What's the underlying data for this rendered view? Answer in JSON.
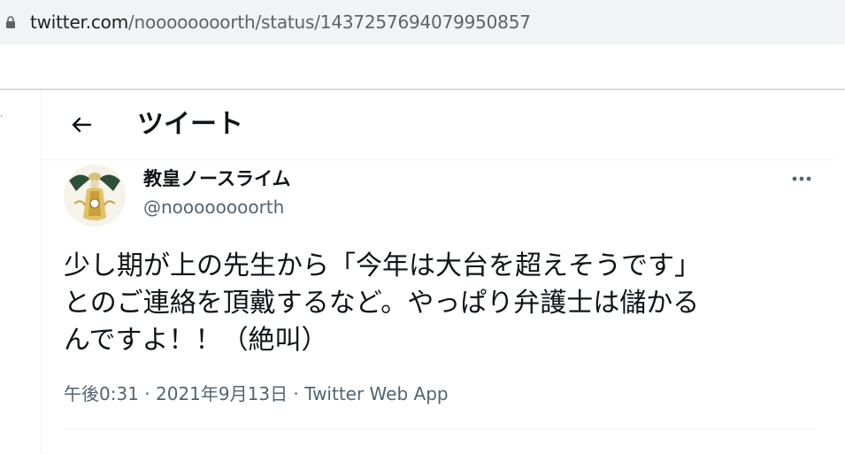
{
  "browser": {
    "url_host": "twitter.com",
    "url_path": "/noooooooorth/status/1437257694079950857"
  },
  "header": {
    "title": "ツイート"
  },
  "tweet": {
    "display_name": "教皇ノースライム",
    "handle": "@noooooooorth",
    "text_lines": [
      "少し期が上の先生から「今年は大台を超えそうです」",
      "とのご連絡を頂戴するなど。やっぱり弁護士は儲かる",
      "んですよ！！（絶叫）"
    ],
    "time": "午後0:31",
    "date": "2021年9月13日",
    "source": "Twitter Web App",
    "separator": " · "
  },
  "icons": {
    "lock": "lock-icon",
    "back": "arrow-left-icon",
    "more": "more-horizontal-icon",
    "avatar": "avatar-image"
  },
  "colors": {
    "text_primary": "#0f1419",
    "text_secondary": "#536471",
    "accent": "#1d9bf0",
    "address_bar": "#f1f3f4"
  }
}
